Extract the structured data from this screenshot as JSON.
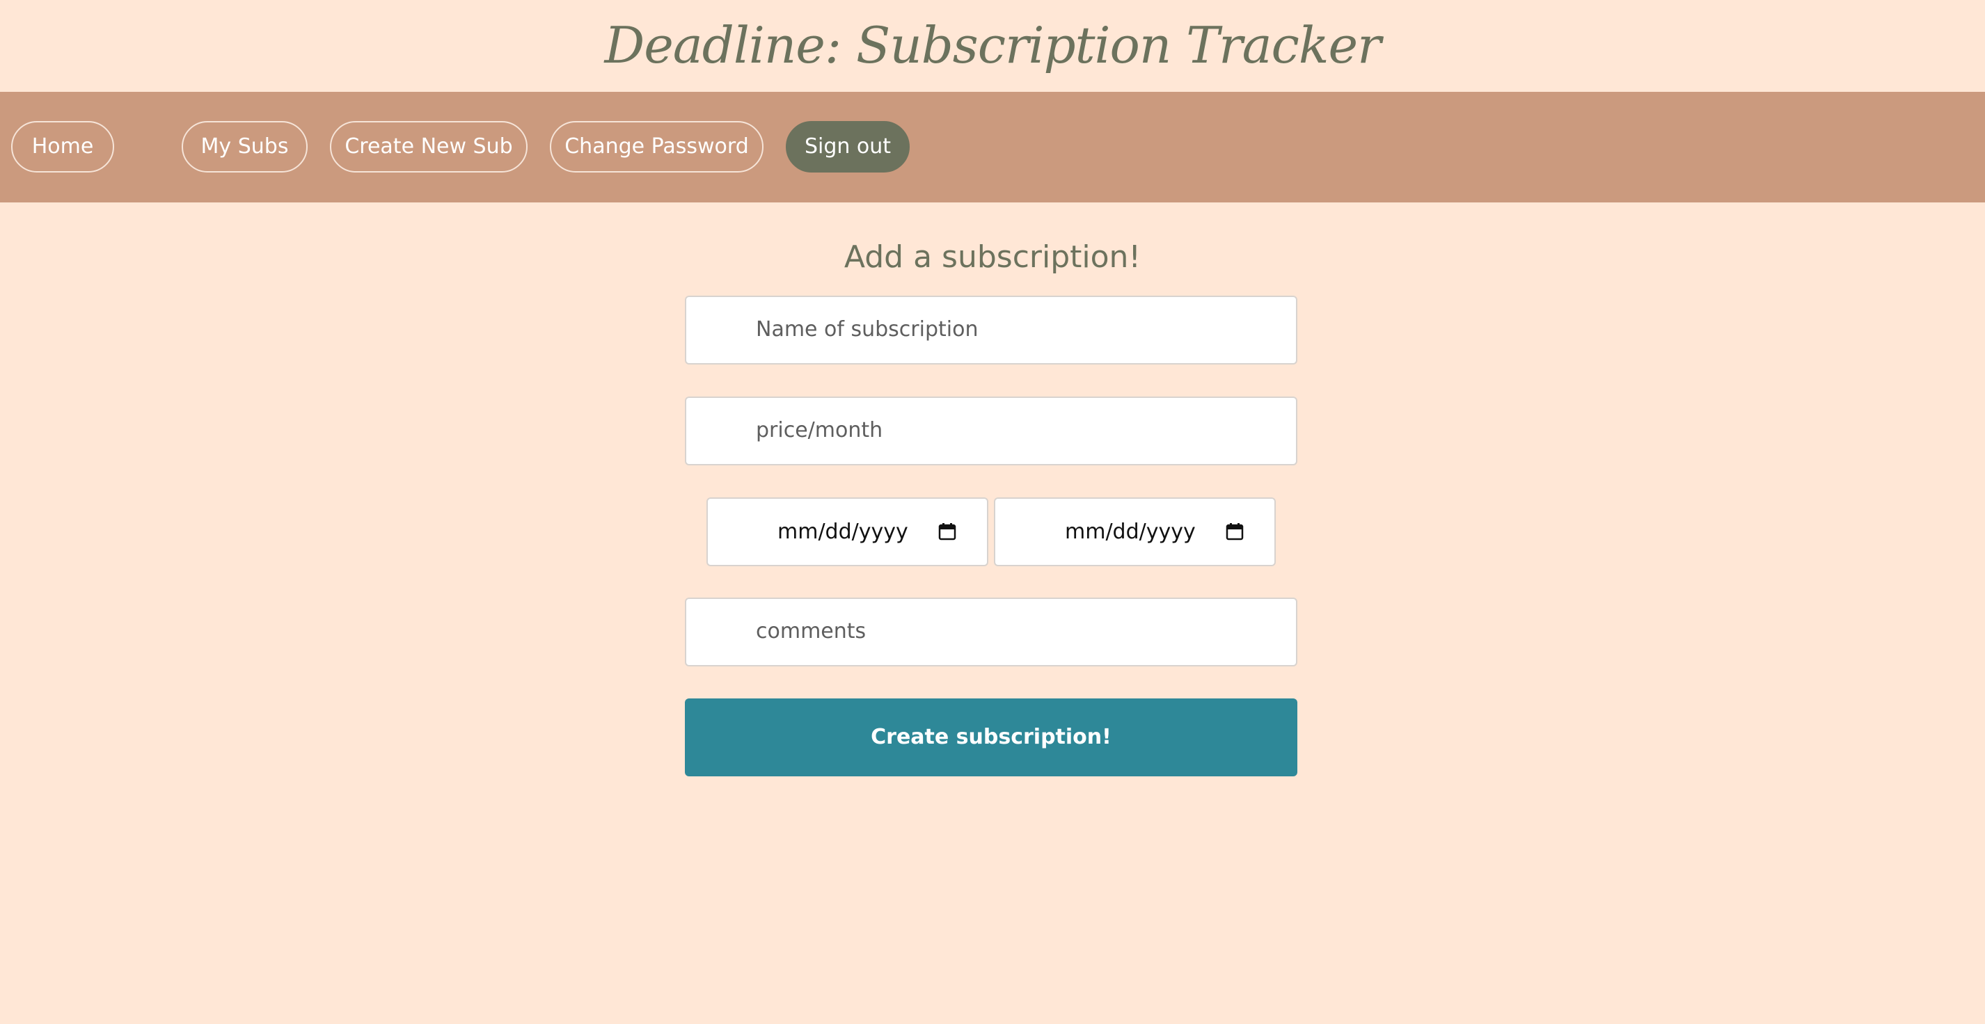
{
  "header": {
    "title": "Deadline: Subscription Tracker"
  },
  "nav": {
    "items": [
      {
        "label": "Home"
      },
      {
        "label": "My Subs"
      },
      {
        "label": "Create New Sub"
      },
      {
        "label": "Change Password"
      },
      {
        "label": "Sign out"
      }
    ]
  },
  "form": {
    "heading": "Add a subscription!",
    "name_placeholder": "Name of subscription",
    "price_placeholder": "price/month",
    "start_date_placeholder": "mm/dd/yyyy",
    "end_date_placeholder": "mm/dd/yyyy",
    "comments_placeholder": "comments",
    "submit_label": "Create subscription!"
  },
  "icons": {
    "date_icon": "calendar-icon"
  },
  "colors": {
    "background": "#ffe7d6",
    "navbar": "#cb9a7e",
    "accent_olive": "#6c725d",
    "submit": "#2e8898"
  }
}
